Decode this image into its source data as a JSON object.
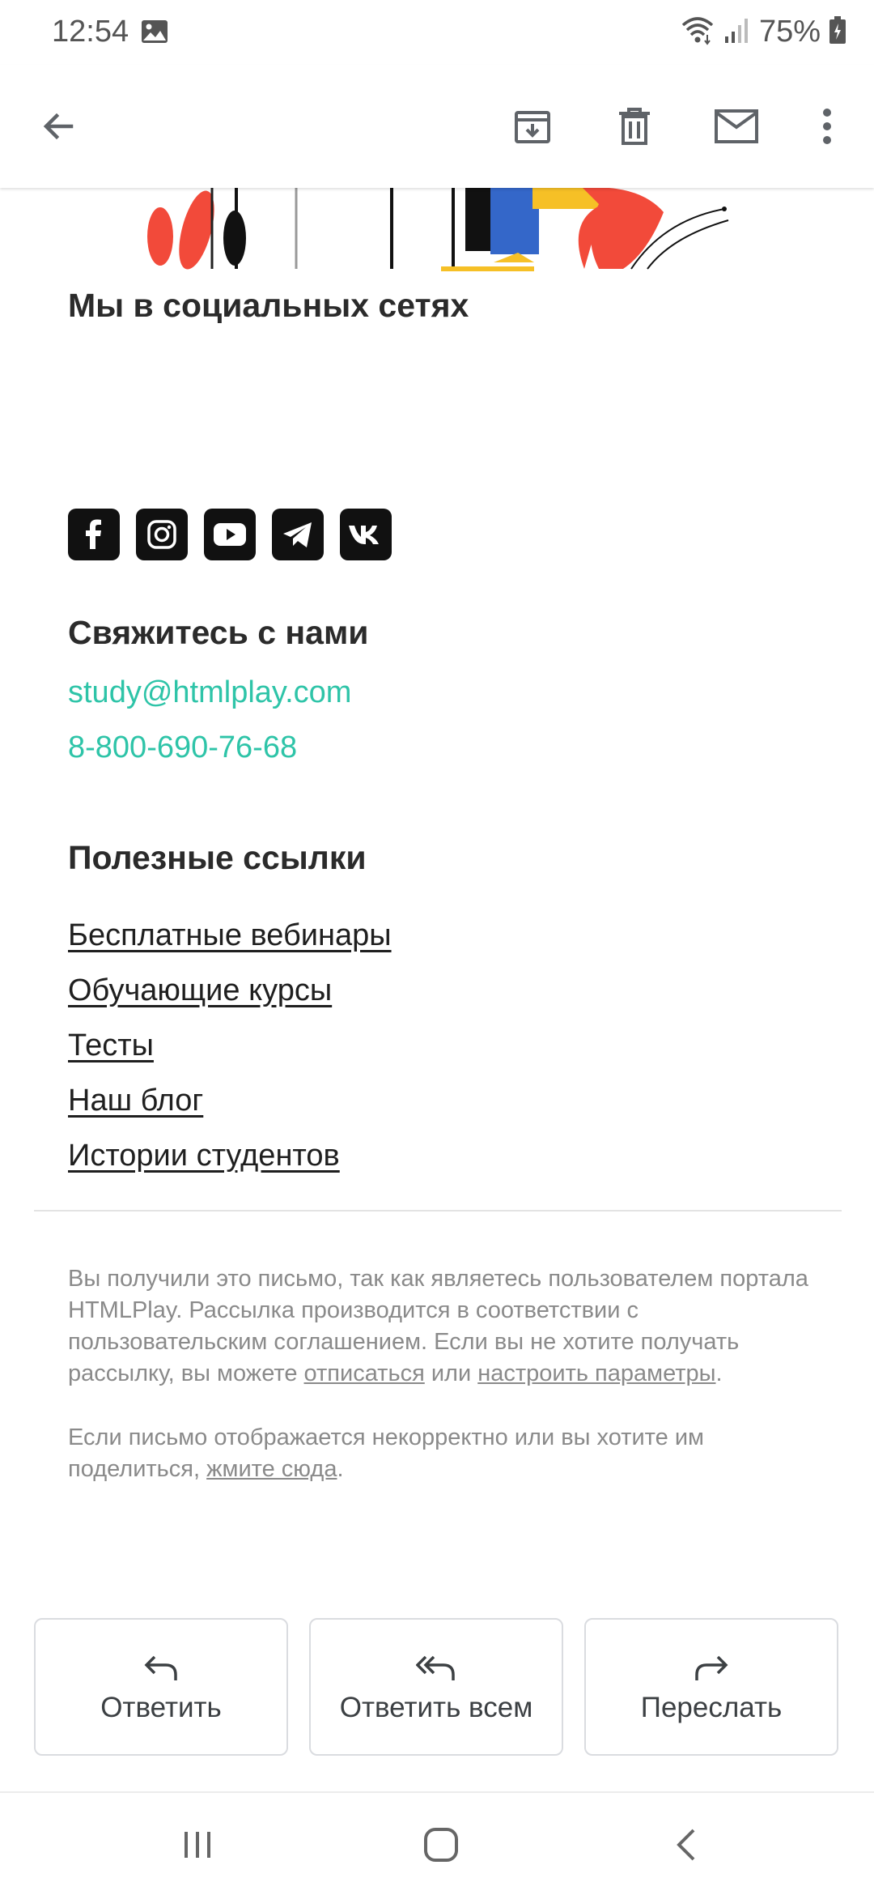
{
  "status_bar": {
    "time": "12:54",
    "battery": "75%",
    "icons": [
      "image-icon",
      "wifi-icon",
      "signal-icon",
      "battery-icon"
    ]
  },
  "app_bar": {
    "icons": [
      "back-arrow-icon",
      "archive-icon",
      "trash-icon",
      "mail-icon",
      "more-vert-icon"
    ]
  },
  "email": {
    "social_heading": "Мы в социальных сетях",
    "socials": [
      "facebook-icon",
      "instagram-icon",
      "youtube-icon",
      "telegram-icon",
      "vk-icon"
    ],
    "contact_heading": "Свяжитесь с нами",
    "contact_email": "study@htmlplay.com",
    "contact_phone": "8-800-690-76-68",
    "links_heading": "Полезные ссылки",
    "links": [
      "Бесплатные вебинары",
      "Обучающие курсы",
      "Тесты",
      "Наш блог",
      "Истории студентов"
    ],
    "footer": {
      "p1_text": "Вы получили это письмо, так как являетесь пользователем портала HTMLPlay. Рассылка производится в соответствии с пользовательским соглашением. Если вы не хотите получать рассылку, вы можете ",
      "unsubscribe": "отписаться",
      "p1_or": " или ",
      "settings": "настроить параметры",
      "p1_end": ".",
      "p2_text": "Если письмо отображается некорректно или вы хотите им поделиться, ",
      "click_here": "жмите сюда",
      "p2_end": "."
    }
  },
  "actions": {
    "reply": "Ответить",
    "reply_all": "Ответить всем",
    "forward": "Переслать"
  },
  "nav_bar": {
    "icons": [
      "recent-apps-icon",
      "home-icon",
      "back-icon"
    ]
  },
  "colors": {
    "link_accent": "#2ec4a8",
    "illustration_red": "#f24a3a",
    "illustration_yellow": "#f6c026",
    "illustration_blue": "#3467c9"
  }
}
